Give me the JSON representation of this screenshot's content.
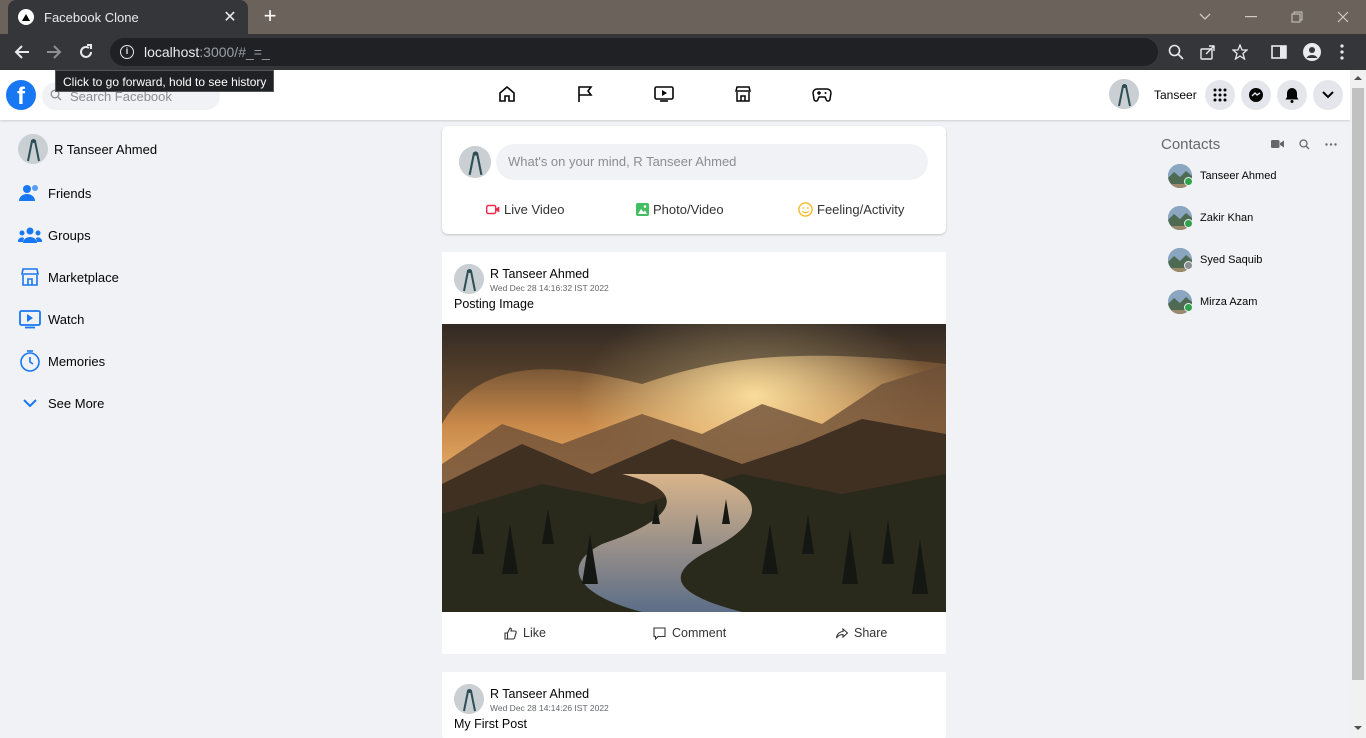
{
  "browser": {
    "tab_title": "Facebook Clone",
    "url_host": "localhost",
    "url_rest": ":3000/#_=_",
    "tooltip": "Click to go forward, hold to see history"
  },
  "header": {
    "search_placeholder": "Search Facebook",
    "user_name": "Tanseer",
    "nav_icons": [
      "home-icon",
      "flag-icon",
      "watch-icon",
      "marketplace-icon",
      "gaming-icon"
    ]
  },
  "sidebar": {
    "items": [
      {
        "label": "R Tanseer Ahmed",
        "icon": "avatar"
      },
      {
        "label": "Friends",
        "icon": "friends-icon"
      },
      {
        "label": "Groups",
        "icon": "groups-icon"
      },
      {
        "label": "Marketplace",
        "icon": "marketplace-icon"
      },
      {
        "label": "Watch",
        "icon": "watch-icon"
      },
      {
        "label": "Memories",
        "icon": "memories-icon"
      },
      {
        "label": "See More",
        "icon": "chevron-down-icon"
      }
    ]
  },
  "composer": {
    "placeholder": "What's on your mind, R Tanseer Ahmed",
    "actions": [
      "Live Video",
      "Photo/Video",
      "Feeling/Activity"
    ]
  },
  "posts": [
    {
      "author": "R Tanseer Ahmed",
      "time": "Wed Dec 28 14:16:32 IST 2022",
      "text": "Posting Image",
      "actions": [
        "Like",
        "Comment",
        "Share"
      ]
    },
    {
      "author": "R Tanseer Ahmed",
      "time": "Wed Dec 28 14:14:26 IST 2022",
      "text": "My First Post"
    }
  ],
  "contacts": {
    "title": "Contacts",
    "list": [
      {
        "name": "Tanseer Ahmed",
        "status": "online"
      },
      {
        "name": "Zakir Khan",
        "status": "online"
      },
      {
        "name": "Syed Saquib",
        "status": "offline"
      },
      {
        "name": "Mirza Azam",
        "status": "online"
      }
    ]
  },
  "colors": {
    "brand": "#1877f2",
    "online": "#31a24c",
    "offline": "#8a8d91",
    "live_video": "#f02849",
    "photo_video": "#45bd62",
    "feeling": "#f7b928"
  }
}
